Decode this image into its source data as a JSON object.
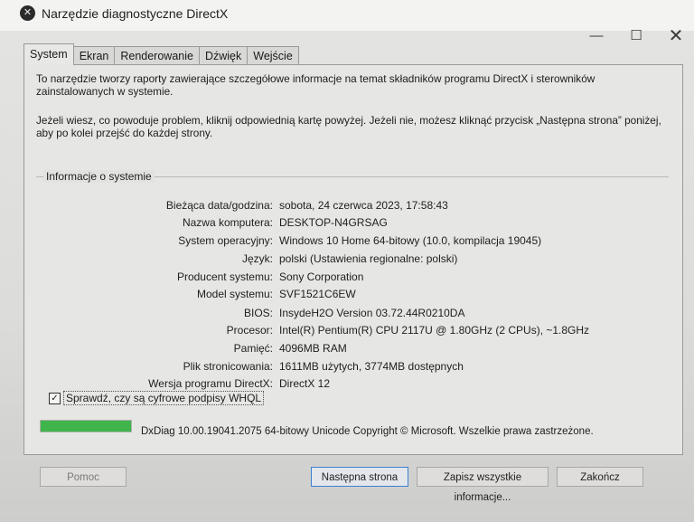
{
  "window": {
    "title": "Narzędzie diagnostyczne DirectX",
    "minimize_glyph": "—",
    "maximize_glyph": "☐",
    "close_glyph": "✕"
  },
  "tabs": [
    {
      "label": "System"
    },
    {
      "label": "Ekran"
    },
    {
      "label": "Renderowanie"
    },
    {
      "label": "Dźwięk"
    },
    {
      "label": "Wejście"
    }
  ],
  "intro": {
    "p1": "To narzędzie tworzy raporty zawierające szczegółowe informacje na temat składników programu DirectX i sterowników zainstalowanych w systemie.",
    "p2": "Jeżeli wiesz, co powoduje problem, kliknij odpowiednią kartę powyżej. Jeżeli nie, możesz kliknąć przycisk „Następna strona” poniżej, aby po kolei przejść do każdej strony."
  },
  "system_info": {
    "group_title": "Informacje o systemie",
    "rows": [
      {
        "label": "Bieżąca data/godzina:",
        "value": "sobota, 24 czerwca 2023, 17:58:43"
      },
      {
        "label": "Nazwa komputera:",
        "value": "DESKTOP-N4GRSAG"
      },
      {
        "label": "System operacyjny:",
        "value": "Windows 10 Home 64-bitowy (10.0, kompilacja 19045)"
      },
      {
        "label": "Język:",
        "value": "polski (Ustawienia regionalne: polski)"
      },
      {
        "label": "Producent systemu:",
        "value": "Sony Corporation"
      },
      {
        "label": "Model systemu:",
        "value": "SVF1521C6EW"
      },
      {
        "label": "BIOS:",
        "value": "InsydeH2O Version 03.72.44R0210DA"
      },
      {
        "label": "Procesor:",
        "value": "Intel(R) Pentium(R) CPU 2117U @ 1.80GHz (2 CPUs), ~1.8GHz"
      },
      {
        "label": "Pamięć:",
        "value": "4096MB RAM"
      },
      {
        "label": "Plik stronicowania:",
        "value": "1611MB użytych, 3774MB dostępnych"
      },
      {
        "label": "Wersja programu DirectX:",
        "value": "DirectX 12"
      }
    ]
  },
  "whql_checkbox": {
    "label": "Sprawdź, czy są cyfrowe podpisy WHQL",
    "checked_glyph": "✓"
  },
  "progress": {
    "fraction": 1.0
  },
  "footer": {
    "text": "DxDiag 10.00.19041.2075 64-bitowy Unicode  Copyright © Microsoft. Wszelkie prawa zastrzeżone."
  },
  "buttons": {
    "help": "Pomoc",
    "next": "Następna strona",
    "save": "Zapisz wszystkie informacje...",
    "exit": "Zakończ"
  },
  "colors": {
    "progress_fill": "#3fb44a",
    "primary_border": "#3c7fd0"
  }
}
